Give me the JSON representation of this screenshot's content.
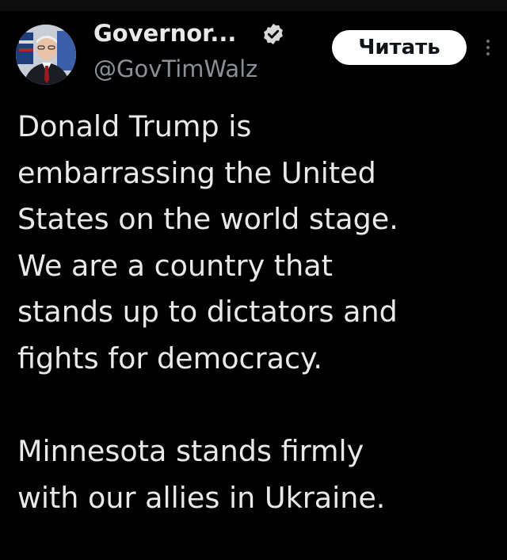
{
  "tweet": {
    "author": {
      "display_name": "Governor...",
      "handle": "@GovTimWalz",
      "verified_icon": "verified-badge-icon",
      "avatar": "profile-photo"
    },
    "follow_label": "Читать",
    "more_icon": "more-vertical-icon",
    "paragraphs": [
      "Donald Trump is\nembarrassing the United\nStates on the world stage.\nWe are a country that\nstands up to dictators and\nfights for democracy.",
      "Minnesota stands firmly\nwith our allies in Ukraine."
    ]
  },
  "colors": {
    "background": "#000000",
    "text": "#e7e9ea",
    "secondary_text": "#8b9096",
    "button_bg": "#ffffff",
    "button_text": "#0f1419"
  }
}
